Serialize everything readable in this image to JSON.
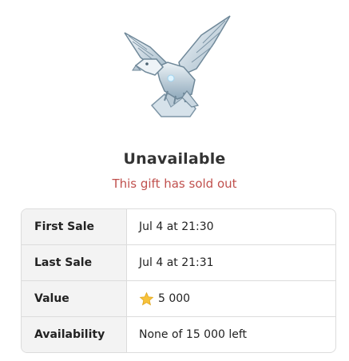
{
  "gift": {
    "image_icon": "crystal-eagle-icon",
    "status_title": "Unavailable",
    "status_subtitle": "This gift has sold out",
    "subtitle_color": "#c0504d"
  },
  "details": [
    {
      "label": "First Sale",
      "value": "Jul 4 at 21:30"
    },
    {
      "label": "Last Sale",
      "value": "Jul 4 at 21:31"
    },
    {
      "label": "Value",
      "value": "5 000",
      "icon": "star-icon"
    },
    {
      "label": "Availability",
      "value": "None of 15 000 left"
    }
  ]
}
